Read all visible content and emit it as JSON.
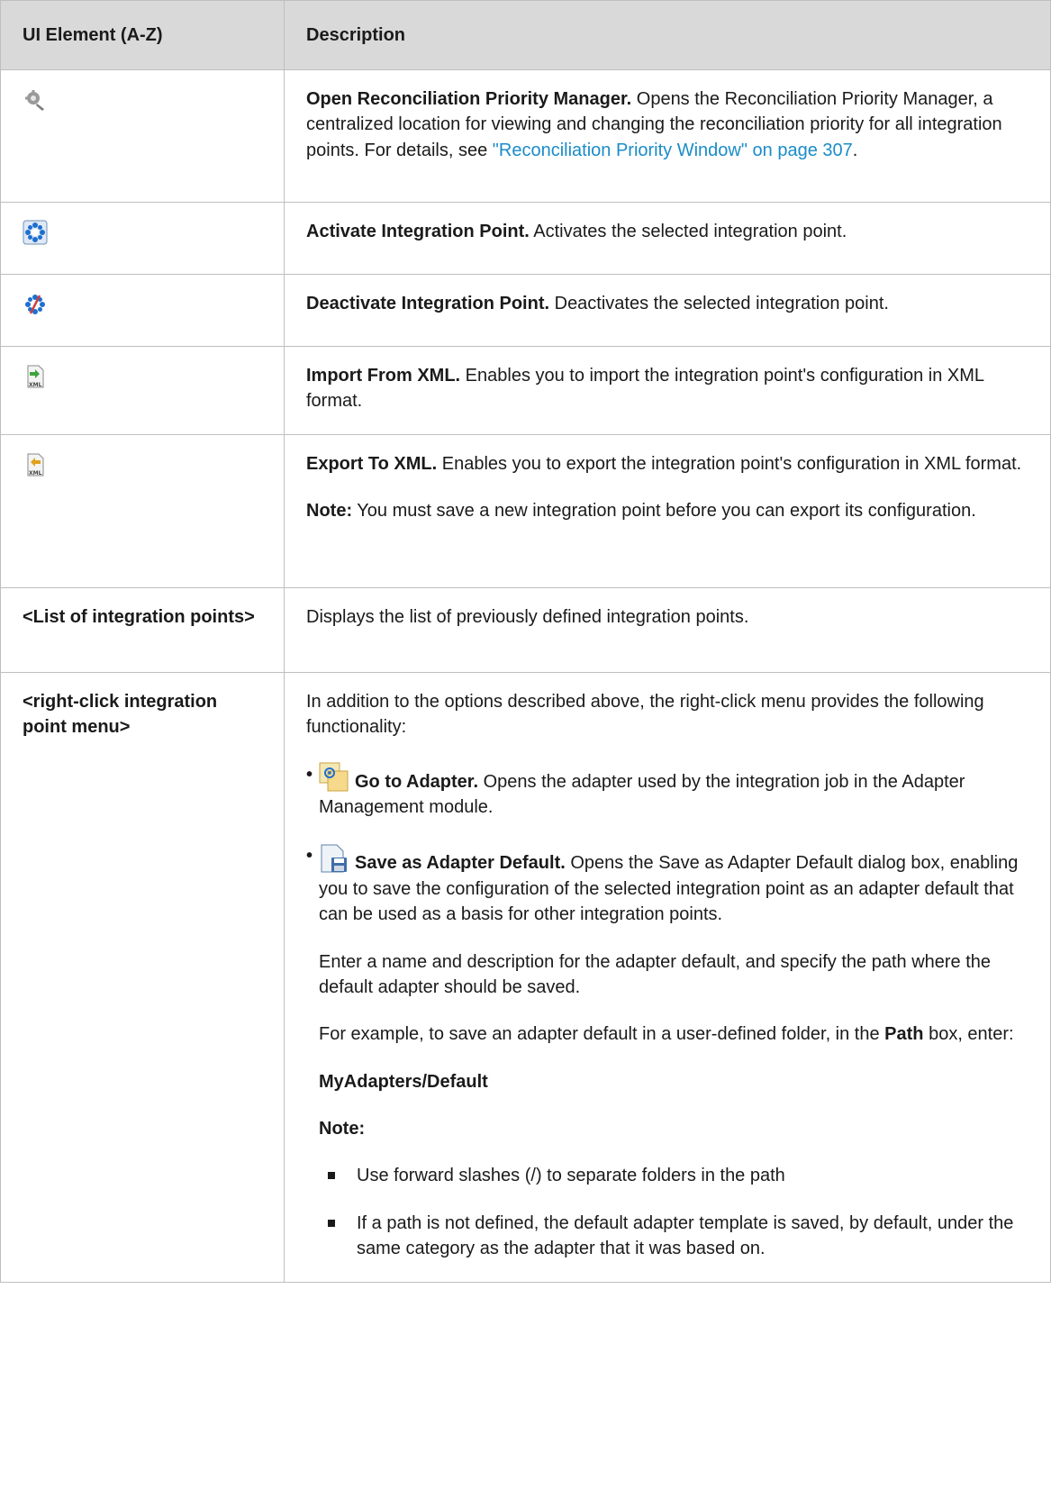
{
  "header": {
    "col1": "UI Element (A-Z)",
    "col2": "Description"
  },
  "rows": {
    "reconcile": {
      "icon": "reconciliation-priority-icon",
      "title": "Open Reconciliation Priority Manager.",
      "text": " Opens the Reconciliation Priority Manager, a centralized location for viewing and changing the reconciliation priority for all integration points. For details, see ",
      "link": "\"Reconciliation Priority Window\" on page 307",
      "end": "."
    },
    "activate": {
      "icon": "activate-integration-point-icon",
      "title": "Activate Integration Point.",
      "text": " Activates the selected integration point."
    },
    "deactivate": {
      "icon": "deactivate-integration-point-icon",
      "title": "Deactivate Integration Point.",
      "text": " Deactivates the selected integration point."
    },
    "import": {
      "icon": "import-xml-icon",
      "title": "Import From XML.",
      "text": " Enables you to import the integration point's configuration in XML format."
    },
    "export": {
      "icon": "export-xml-icon",
      "title": "Export To XML.",
      "text": " Enables you to export the integration point's configuration in XML format.",
      "note_label": "Note:",
      "note_text": " You must save a new integration point before you can export its configuration."
    },
    "list": {
      "element": "<List of integration points>",
      "text": "Displays the list of previously defined integration points."
    },
    "rightclick": {
      "element": "<right-click integration point menu>",
      "intro": "In addition to the options described above, the right-click menu provides the following functionality:",
      "goto": {
        "icon": "go-to-adapter-icon",
        "title": "Go to Adapter.",
        "text": " Opens the adapter used by the integration job in the Adapter Management module."
      },
      "save": {
        "icon": "save-adapter-default-icon",
        "title": "Save as Adapter Default.",
        "text": " Opens the Save as Adapter Default dialog box, enabling you to save the configuration of the selected integration point as an adapter default that can be used as a basis for other integration points.",
        "p2": "Enter a name and description for the adapter default, and specify the path where the default adapter should be saved.",
        "p3_a": "For example, to save an adapter default in a user-defined folder, in the ",
        "p3_b": "Path",
        "p3_c": " box, enter:",
        "path_example": "MyAdapters/Default",
        "note_label": "Note:",
        "notes": [
          "Use forward slashes (/) to separate folders in the path",
          "If a path is not defined, the default adapter template is saved, by default, under the same category as the adapter that it was based on."
        ]
      }
    }
  },
  "colors": {
    "header_bg": "#d9d9d9",
    "border": "#bfbfbf",
    "link": "#1a8cc8"
  }
}
